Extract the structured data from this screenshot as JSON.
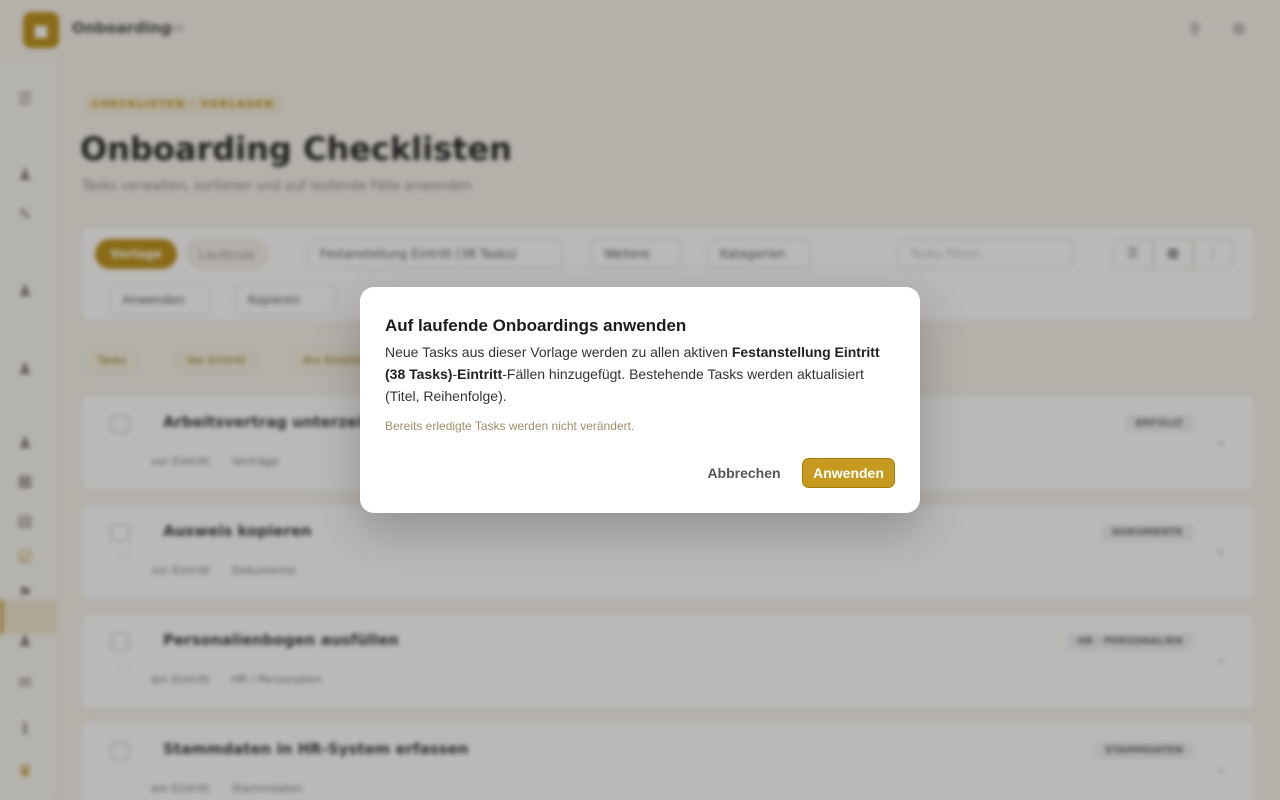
{
  "app": {
    "brand": "Onboarding",
    "brand_sub": "HR",
    "logo_icon": "folder-icon",
    "top_icons": [
      "search-icon",
      "settings-icon"
    ]
  },
  "page": {
    "eyebrow": "CHECKLISTEN · VORLAGEN",
    "title": "Onboarding Checklisten",
    "subtitle": "Tasks verwalten, sortieren und auf laufende Fälle anwenden"
  },
  "toolbar": {
    "mode_active": "Vorlage",
    "mode_inactive": "Laufende",
    "template_select": "Festanstellung Eintritt (38 Tasks)",
    "more_label": "Weitere",
    "category_label": "Kategorien",
    "search_placeholder": "Tasks filtern",
    "sub_actions": [
      "Anwenden",
      "Kopieren"
    ]
  },
  "filters": [
    "Tasks",
    "Vor Eintritt",
    "Am Eintritt"
  ],
  "tasks": [
    {
      "title": "Arbeitsvertrag unterzeichnen",
      "due": "vor Eintritt",
      "category": "Verträge",
      "badge": "ERFÜLLT"
    },
    {
      "title": "Ausweis kopieren",
      "due": "vor Eintritt",
      "category": "Dokumente",
      "badge": "DOKUMENTE"
    },
    {
      "title": "Personalienbogen ausfüllen",
      "due": "am Eintritt",
      "category": "HR / Personalien",
      "badge": "HR · PERSONALIEN"
    },
    {
      "title": "Stammdaten in HR-System erfassen",
      "due": "am Eintritt",
      "category": "Stammdaten",
      "badge": "STAMMDATEN"
    }
  ],
  "dialog": {
    "title": "Auf laufende Onboardings anwenden",
    "body_pre": "Neue Tasks aus dieser Vorlage werden zu allen aktiven ",
    "body_bold1": "Festanstellung Eintritt (38 Tasks)",
    "body_mid": "-",
    "body_bold2": "Eintritt",
    "body_post": "-Fällen hinzugefügt. Bestehende Tasks werden aktualisiert (Titel, Reihenfolge).",
    "note": "Bereits erledigte Tasks werden nicht verändert.",
    "cancel_label": "Abbrechen",
    "apply_label": "Anwenden",
    "accent": "#c59a1e"
  }
}
